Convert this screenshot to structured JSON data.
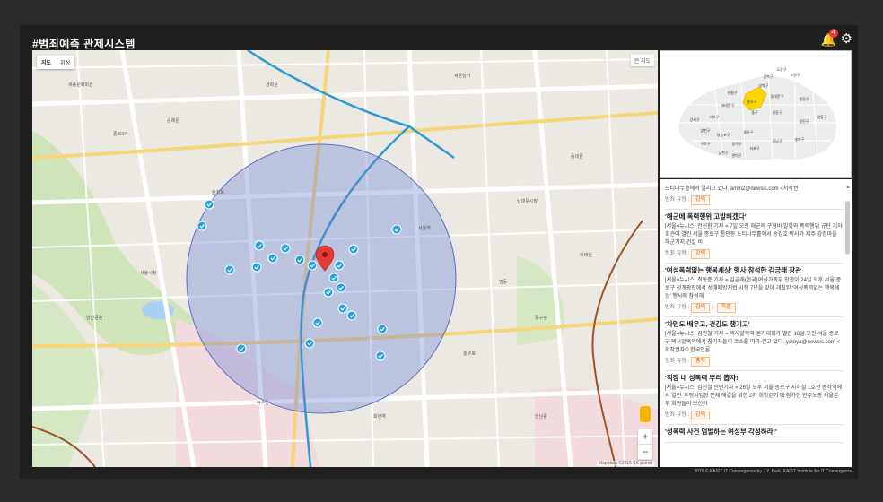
{
  "app": {
    "title": "#범죄예측 관제시스템",
    "notification_count": "4"
  },
  "map": {
    "maptype": {
      "map_label": "지도",
      "satellite_label": "위성"
    },
    "search_label": "큰 지도",
    "credit": "Map data ©2015 SK planet",
    "zoom_in": "+",
    "zoom_out": "−",
    "labels": [
      "세운상가",
      "종로3가",
      "서울시청",
      "덕수궁",
      "명동",
      "충무로",
      "남산공원",
      "회현역",
      "동대문",
      "을지로",
      "서울역",
      "한남동",
      "남대문시장",
      "세종문화회관",
      "이태원",
      "광화문",
      "중구청",
      "숭례문"
    ]
  },
  "minimap": {
    "districts": [
      "종로구",
      "중구",
      "서대문구",
      "마포구",
      "용산구",
      "성동구",
      "동대문구",
      "성북구",
      "광진구",
      "강남구",
      "서초구",
      "송파구",
      "강동구",
      "영등포구",
      "동작구",
      "관악구",
      "강서구",
      "양천구",
      "구로구",
      "금천구",
      "노원구",
      "도봉구",
      "강북구",
      "은평구",
      "중랑구"
    ],
    "highlight_color": "#ffd500"
  },
  "news": {
    "category_prefix": "범죄 유형 :",
    "items": [
      {
        "title": "",
        "body": "느티나무홀에서 열리고 있다. amin2@newsis.com <저작권",
        "tags": [
          "강력"
        ]
      },
      {
        "title": "'해군에 폭력행위 고발해겠다'",
        "body": "[서울=뉴시스] 전진환 기자 = 7일 오전 해군의 구형비 발화와 폭력행위 규탄 기자회견이 열린 서울 종로구 통인동 느티나무홀에서 송강호 박사가 제주 강정마을 해군기지 건설 비",
        "tags": [
          "강력"
        ]
      },
      {
        "title": "'여성폭력없는 행복세상' 행사 참석한 김금래 장관",
        "body": "[서울=뉴시스] 최동준 기자 = 김금래(한국)여성가족부 장관이 24일 오후 서울 종로구 청계광장에서 성매매방지법 시행 7년을 맞아 개최된 '여성폭력없는 행복세상' 행사에 참석해",
        "tags": [
          "강력",
          "특별"
        ]
      },
      {
        "title": "'차인도 배우고, 건강도 챙기고'",
        "body": "[서울=뉴시스] 김인철 기자 = 택사알복외 걷기대회가 열린 18일 오전 서울 종로구 택사알복외에서 참가자들이 코스를 따라 걷고 있다. yatoya@newsis.com <저작권자© 한국언론",
        "tags": [
          "흉악"
        ]
      },
      {
        "title": "'직장 내 성폭력 뿌리 뽑자!'",
        "body": "[서울=뉴시스] 김진철 인턴기자 = 26일 오후 서울 종로구 지하철 1호선 종각역에서 열린 '투쟁사업장 문제 해결을 위한 2차 희망걷기'에 참가한 민주노총 서울본부 회원들이 보신각",
        "tags": [
          "강력"
        ]
      },
      {
        "title": "'성폭력 사건 엄벌하는 여성부 각성하라!'",
        "body": "",
        "tags": []
      }
    ]
  },
  "footer": "2015 © KAIST IT Convergence by J.Y. Park. KAIST Institute for IT Convergence"
}
